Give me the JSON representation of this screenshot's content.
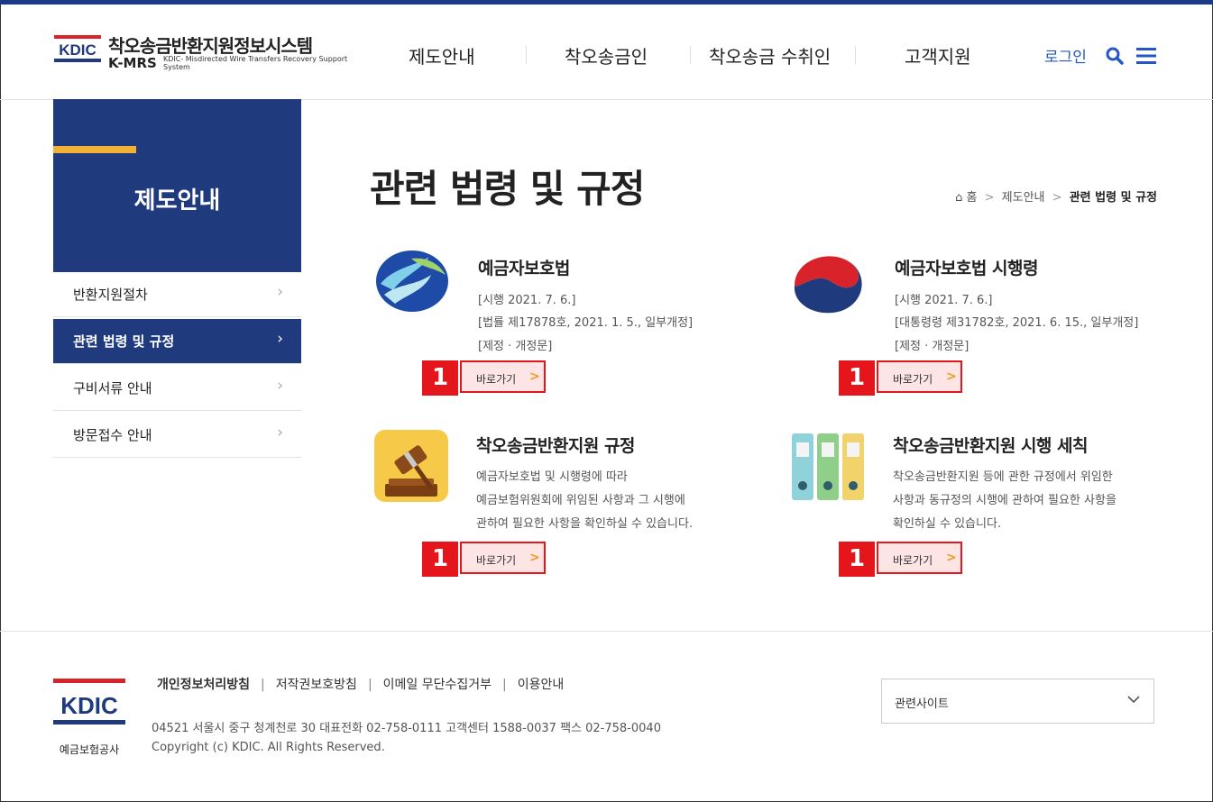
{
  "brand": {
    "logo_text": "KDIC",
    "title": "착오송금반환지원정보시스템",
    "abbr": "K-MRS",
    "subtitle": "KDIC- Misdirected Wire Transfers Recovery Support System"
  },
  "nav": {
    "items": [
      "제도안내",
      "착오송금인",
      "착오송금 수취인",
      "고객지원"
    ],
    "login": "로그인"
  },
  "sidebar": {
    "title": "제도안내",
    "items": [
      {
        "label": "반환지원절차",
        "arrow": "›"
      },
      {
        "label": "관련 법령 및 규정",
        "arrow": "›"
      },
      {
        "label": "구비서류 안내",
        "arrow": "›"
      },
      {
        "label": "방문접수 안내",
        "arrow": "›"
      }
    ]
  },
  "main": {
    "title": "관련 법령 및 규정",
    "breadcrumb": {
      "home": "홈",
      "sep": ">",
      "parent": "제도안내",
      "current": "관련 법령 및 규정"
    },
    "cards": [
      {
        "title": "예금자보호법",
        "lines": [
          "[시행 2021. 7. 6.]",
          "[법률 제17878호, 2021. 1. 5., 일부개정]",
          "[제정 · 개정문]"
        ],
        "button": "바로가기",
        "arrow": ">",
        "badge": "1"
      },
      {
        "title": "예금자보호법 시행령",
        "lines": [
          "[시행 2021. 7. 6.]",
          "[대통령령 제31782호, 2021. 6. 15., 일부개정]",
          "[제정 · 개정문]"
        ],
        "button": "바로가기",
        "arrow": ">",
        "badge": "1"
      },
      {
        "title": "착오송금반환지원 규정",
        "lines": [
          "예금자보호법 및 시행령에 따라",
          "예금보험위원회에 위임된 사항과 그 시행에",
          "관하여 필요한 사항을 확인하실 수 있습니다."
        ],
        "button": "바로가기",
        "arrow": ">",
        "badge": "1"
      },
      {
        "title": "착오송금반환지원 시행 세칙",
        "lines": [
          "착오송금반환지원 등에 관한 규정에서 위임한",
          "사항과 동규정의 시행에 관하여 필요한 사항을",
          "확인하실 수 있습니다."
        ],
        "button": "바로가기",
        "arrow": ">",
        "badge": "1"
      }
    ]
  },
  "footer": {
    "logo_text": "KDIC",
    "org": "예금보험공사",
    "links": [
      "개인정보처리방침",
      "저작권보호방침",
      "이메일 무단수집거부",
      "이용안내"
    ],
    "link_sep": "|",
    "address": "04521 서울시 중구 청계천로 30   대표전화 02-758-0111   고객센터 1588-0037   팩스 02-758-0040",
    "copyright": "Copyright (c) KDIC. All Rights Reserved.",
    "related_site": "관련사이트"
  },
  "colors": {
    "brand_navy": "#1f3a7d",
    "accent_yellow": "#f2b134",
    "link_blue": "#2457c5",
    "badge_red": "#e4161b"
  }
}
